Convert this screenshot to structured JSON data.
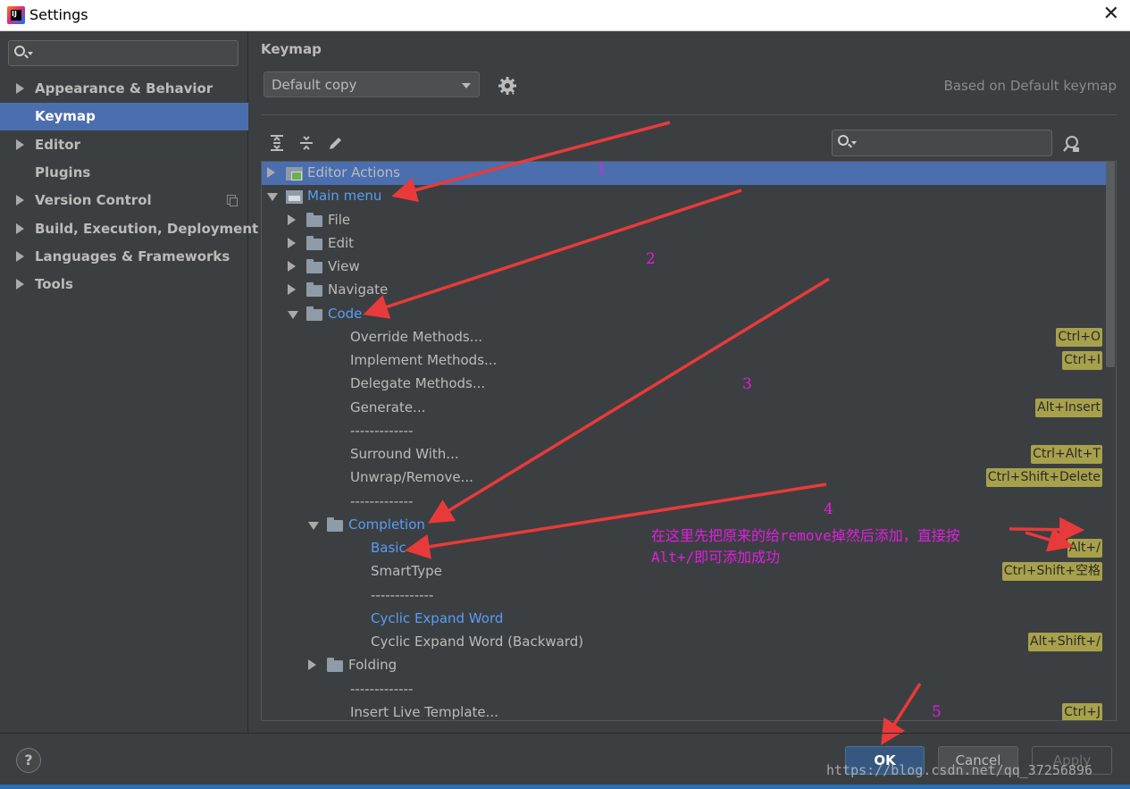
{
  "window": {
    "title": "Settings",
    "logo_text": "IJ"
  },
  "sidebar": {
    "search_placeholder": "",
    "items": [
      {
        "label": "Appearance & Behavior",
        "expandable": true
      },
      {
        "label": "Keymap",
        "selected": true
      },
      {
        "label": "Editor",
        "expandable": true
      },
      {
        "label": "Plugins"
      },
      {
        "label": "Version Control",
        "expandable": true
      },
      {
        "label": "Build, Execution, Deployment",
        "expandable": true
      },
      {
        "label": "Languages & Frameworks",
        "expandable": true
      },
      {
        "label": "Tools",
        "expandable": true
      }
    ]
  },
  "main": {
    "title": "Keymap",
    "keymap_select": "Default copy",
    "based_on": "Based on Default keymap",
    "search_placeholder": ""
  },
  "tree": [
    {
      "label": "Editor Actions",
      "kind": "action-group",
      "depth": 0,
      "state": "closed",
      "selected": true
    },
    {
      "label": "Main menu",
      "kind": "menu",
      "depth": 0,
      "state": "open",
      "highlight": true
    },
    {
      "label": "File",
      "kind": "folder",
      "depth": 1,
      "state": "closed"
    },
    {
      "label": "Edit",
      "kind": "folder",
      "depth": 1,
      "state": "closed"
    },
    {
      "label": "View",
      "kind": "folder",
      "depth": 1,
      "state": "closed"
    },
    {
      "label": "Navigate",
      "kind": "folder",
      "depth": 1,
      "state": "closed"
    },
    {
      "label": "Code",
      "kind": "folder",
      "depth": 1,
      "state": "open",
      "highlight": true
    },
    {
      "label": "Override Methods...",
      "kind": "action",
      "depth": 2,
      "shortcut": "Ctrl+O"
    },
    {
      "label": "Implement Methods...",
      "kind": "action",
      "depth": 2,
      "shortcut": "Ctrl+I"
    },
    {
      "label": "Delegate Methods...",
      "kind": "action",
      "depth": 2
    },
    {
      "label": "Generate...",
      "kind": "action",
      "depth": 2,
      "shortcut": "Alt+Insert"
    },
    {
      "label": "-------------",
      "kind": "separator",
      "depth": 2
    },
    {
      "label": "Surround With...",
      "kind": "action",
      "depth": 2,
      "shortcut": "Ctrl+Alt+T"
    },
    {
      "label": "Unwrap/Remove...",
      "kind": "action",
      "depth": 2,
      "shortcut": "Ctrl+Shift+Delete"
    },
    {
      "label": "-------------",
      "kind": "separator",
      "depth": 2
    },
    {
      "label": "Completion",
      "kind": "folder",
      "depth": 2,
      "state": "open",
      "highlight": true
    },
    {
      "label": "Basic",
      "kind": "action",
      "depth": 3,
      "shortcut": "Alt+/",
      "highlight": true
    },
    {
      "label": "SmartType",
      "kind": "action",
      "depth": 3,
      "shortcut": "Ctrl+Shift+空格"
    },
    {
      "label": "-------------",
      "kind": "separator",
      "depth": 3
    },
    {
      "label": "Cyclic Expand Word",
      "kind": "action",
      "depth": 3,
      "highlight": true
    },
    {
      "label": "Cyclic Expand Word (Backward)",
      "kind": "action",
      "depth": 3,
      "shortcut": "Alt+Shift+/"
    },
    {
      "label": "Folding",
      "kind": "folder",
      "depth": 2,
      "state": "closed"
    },
    {
      "label": "-------------",
      "kind": "separator",
      "depth": 2
    },
    {
      "label": "Insert Live Template...",
      "kind": "action",
      "depth": 2,
      "shortcut": "Ctrl+J"
    }
  ],
  "annotations": {
    "numbers": [
      "1",
      "2",
      "3",
      "4",
      "5"
    ],
    "note_line1": "在这里先把原来的给remove掉然后添加，直接按",
    "note_line2": "Alt+/即可添加成功",
    "color": "#e01ee0",
    "arrow_color": "#e83a3a"
  },
  "buttons": {
    "help": "?",
    "ok": "OK",
    "cancel": "Cancel",
    "apply": "Apply"
  },
  "watermark": "https://blog.csdn.net/qq_37256896",
  "colors": {
    "selection": "#4b6eaf",
    "link_blue": "#589df6",
    "shortcut_bg": "#a8a14b",
    "panel_bg": "#3c3f41"
  }
}
